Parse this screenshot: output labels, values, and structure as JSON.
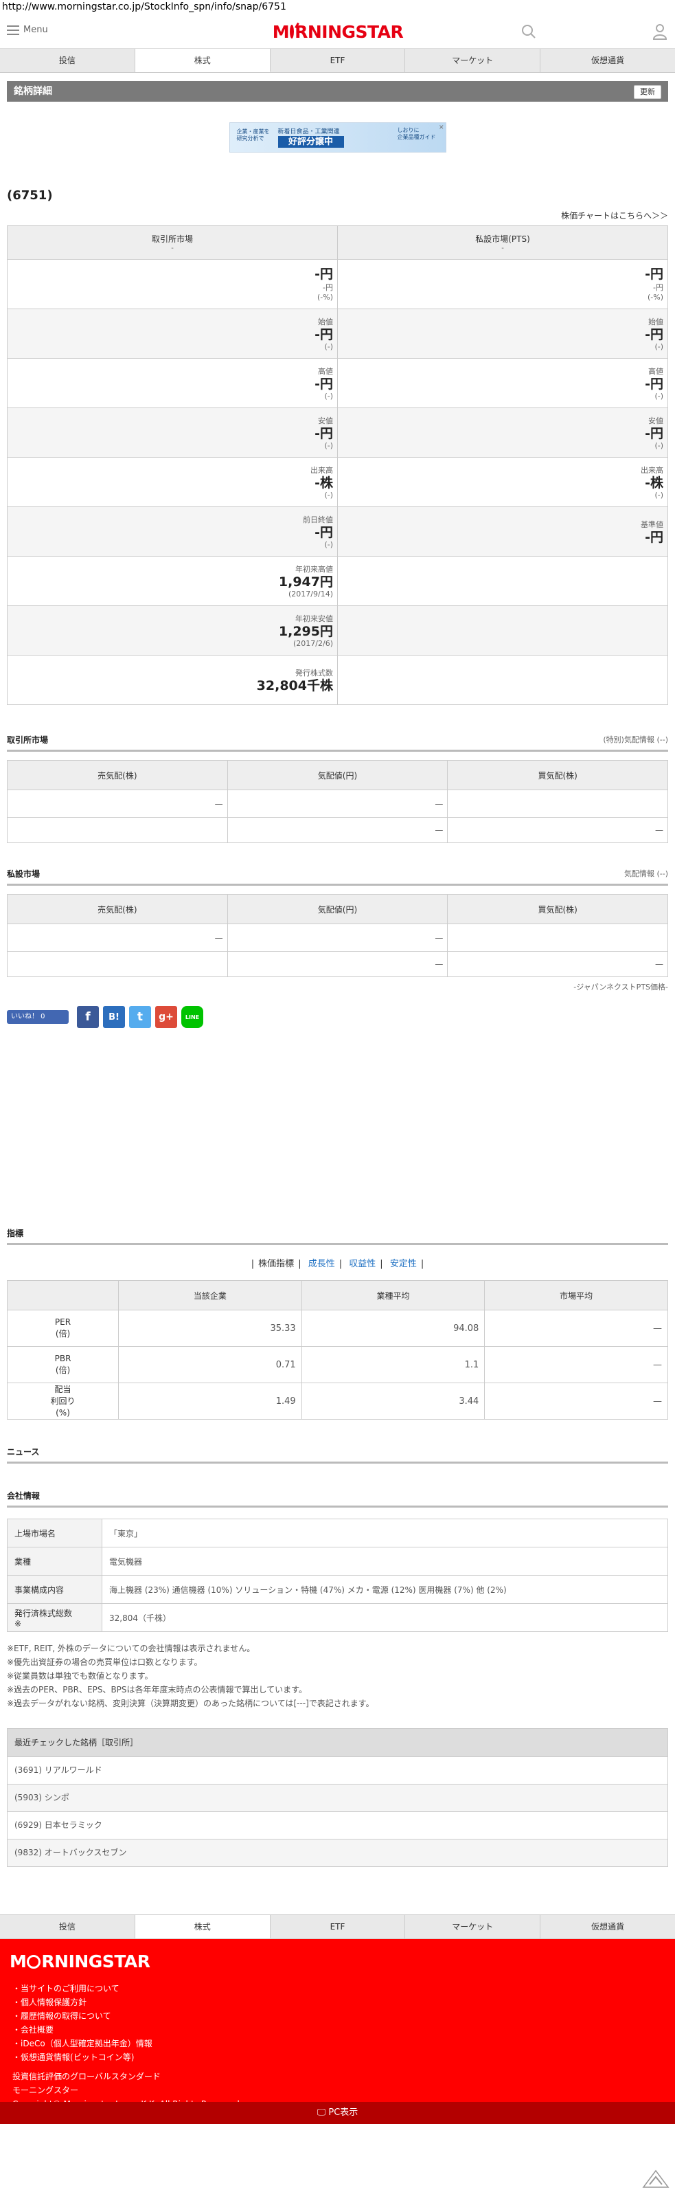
{
  "url": "http://www.morningstar.co.jp/StockInfo_spn/info/snap/6751",
  "header": {
    "menu_label": "Menu",
    "logo": "MORNINGSTAR"
  },
  "tabs": [
    "投信",
    "株式",
    "ETF",
    "マーケット",
    "仮想通貨"
  ],
  "active_tab": "株式",
  "section_title": "銘柄詳細",
  "refresh_label": "更新",
  "banner": {
    "left": "企業・産業を\n研究分析で",
    "mid": "新着日食品・工業関連",
    "big": "好評分譲中",
    "right": "しおりに\n企業品種ガイド"
  },
  "stock_code": "(6751)",
  "chart_link": "株価チャートはこちらへ＞＞",
  "market_table": {
    "col1": {
      "title": "取引所市場",
      "sub": "-"
    },
    "col2": {
      "title": "私設市場(PTS)",
      "sub": "-"
    },
    "rows": [
      {
        "left": {
          "label": "",
          "value": "-円",
          "sub1": "-円",
          "sub2": "(-%)"
        },
        "right": {
          "label": "",
          "value": "-円",
          "sub1": "-円",
          "sub2": "(-%)"
        }
      },
      {
        "left": {
          "label": "始値",
          "value": "-円",
          "sub1": "",
          "sub2": "(-)"
        },
        "right": {
          "label": "始値",
          "value": "-円",
          "sub1": "",
          "sub2": "(-)"
        }
      },
      {
        "left": {
          "label": "高値",
          "value": "-円",
          "sub1": "",
          "sub2": "(-)"
        },
        "right": {
          "label": "高値",
          "value": "-円",
          "sub1": "",
          "sub2": "(-)"
        }
      },
      {
        "left": {
          "label": "安値",
          "value": "-円",
          "sub1": "",
          "sub2": "(-)"
        },
        "right": {
          "label": "安値",
          "value": "-円",
          "sub1": "",
          "sub2": "(-)"
        }
      },
      {
        "left": {
          "label": "出来高",
          "value": "-株",
          "sub1": "",
          "sub2": "(-)"
        },
        "right": {
          "label": "出来高",
          "value": "-株",
          "sub1": "",
          "sub2": "(-)"
        }
      },
      {
        "left": {
          "label": "前日終値",
          "value": "-円",
          "sub1": "",
          "sub2": "(-)"
        },
        "right": {
          "label": "基準値",
          "value": "-円",
          "sub1": "",
          "sub2": ""
        }
      },
      {
        "left": {
          "label": "年初来高値",
          "value": "1,947円",
          "sub1": "",
          "sub2": "(2017/9/14)"
        },
        "right": {
          "label": "",
          "value": "",
          "sub1": "",
          "sub2": ""
        }
      },
      {
        "left": {
          "label": "年初来安値",
          "value": "1,295円",
          "sub1": "",
          "sub2": "(2017/2/6)"
        },
        "right": {
          "label": "",
          "value": "",
          "sub1": "",
          "sub2": ""
        }
      },
      {
        "left": {
          "label": "発行株式数",
          "value": "32,804千株",
          "sub1": "",
          "sub2": ""
        },
        "right": {
          "label": "",
          "value": "",
          "sub1": "",
          "sub2": ""
        }
      }
    ]
  },
  "exchange_section": {
    "title": "取引所市場",
    "right_note": "(特別)気配情報 (--)"
  },
  "pts_section": {
    "title": "私設市場",
    "right_note": "気配情報 (--)"
  },
  "board_headers": [
    "売気配(株)",
    "気配値(円)",
    "買気配(株)"
  ],
  "board_rows": [
    [
      "—",
      "—",
      ""
    ],
    [
      "",
      "—",
      "—"
    ]
  ],
  "pts_note": "-ジャパンネクストPTS価格-",
  "social": {
    "fb_label": "いいね！ 0",
    "icons": [
      "f",
      "B!",
      "t",
      "g+",
      "LINE"
    ]
  },
  "indicator": {
    "title": "指標",
    "links": [
      "株価指標",
      "成長性",
      "収益性",
      "安定性"
    ],
    "headers": [
      "",
      "当該企業",
      "業種平均",
      "市場平均"
    ],
    "rows": [
      {
        "name": "PER\n(倍)",
        "company": "35.33",
        "industry": "94.08",
        "market": "—"
      },
      {
        "name": "PBR\n(倍)",
        "company": "0.71",
        "industry": "1.1",
        "market": "—"
      },
      {
        "name": "配当\n利回り\n(%)",
        "company": "1.49",
        "industry": "3.44",
        "market": "—"
      }
    ]
  },
  "news_title": "ニュース",
  "company": {
    "title": "会社情報",
    "rows": [
      {
        "label": "上場市場名",
        "value": "「東京」"
      },
      {
        "label": "業種",
        "value": "電気機器"
      },
      {
        "label": "事業構成内容",
        "value": "海上機器 (23%) 通信機器 (10%) ソリューション・特機 (47%) メカ・電源 (12%) 医用機器 (7%) 他 (2%)"
      },
      {
        "label": "発行済株式総数\n※",
        "value": "32,804（千株）"
      }
    ]
  },
  "notes": [
    "※ETF, REIT, 外株のデータについての会社情報は表示されません。",
    "※優先出資証券の場合の売買単位は口数となります。",
    "※従業員数は単独でも数値となります。",
    "※過去のPER、PBR、EPS、BPSは各年年度末時点の公表情報で算出しています。",
    "※過去データがれない銘柄、変則決算（決算期変更）のあった銘柄については[---]で表記されます。"
  ],
  "recent": {
    "title": "最近チェックした銘柄［取引所］",
    "items": [
      "(3691) リアルワールド",
      "(5903) シンポ",
      "(6929) 日本セラミック",
      "(9832) オートバックスセブン"
    ]
  },
  "footer": {
    "logo": "MORNINGSTAR",
    "links": [
      "当サイトのご利用について",
      "個人情報保護方針",
      "履歴情報の取得について",
      "会社概要",
      "iDeCo（個人型確定拠出年金）情報",
      "仮想通貨情報(ビットコイン等)"
    ],
    "tagline1": "投資信託評価のグローバルスタンダード",
    "tagline2": "モーニングスター",
    "copyright": "Copyright© Morningstar Japan K.K. All Rights Reserved.",
    "pc_label": "PC表示"
  },
  "colors": {
    "brand": "#e60012",
    "footer": "#ff0000",
    "link": "#1b6ec2"
  }
}
